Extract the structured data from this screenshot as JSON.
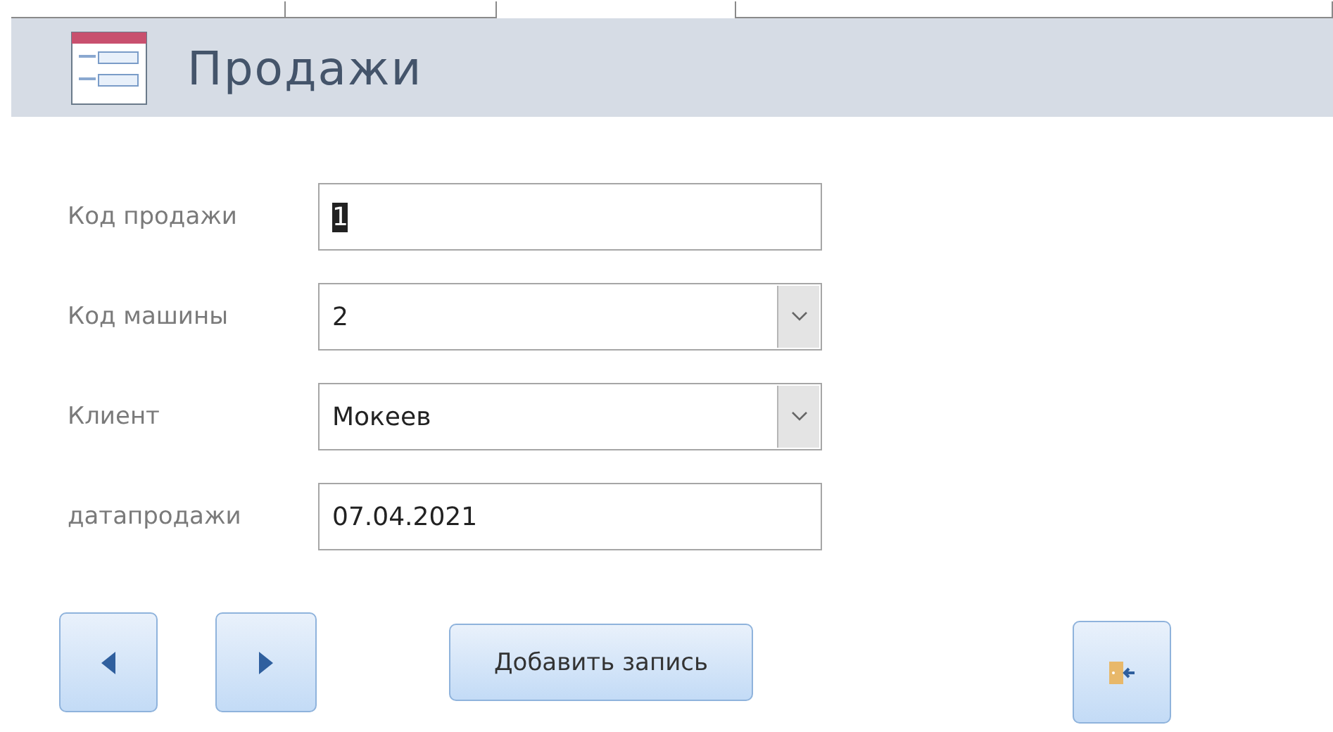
{
  "header": {
    "title": "Продажи"
  },
  "fields": [
    {
      "label": "Код продажи",
      "value": "1",
      "kind": "text",
      "text_selected": true
    },
    {
      "label": "Код машины",
      "value": "2",
      "kind": "combo",
      "text_selected": false
    },
    {
      "label": "Клиент",
      "value": "Мокеев",
      "kind": "combo",
      "text_selected": false
    },
    {
      "label": "датапродажи",
      "value": "07.04.2021",
      "kind": "text",
      "text_selected": false
    }
  ],
  "buttons": {
    "add": "Добавить запись"
  }
}
